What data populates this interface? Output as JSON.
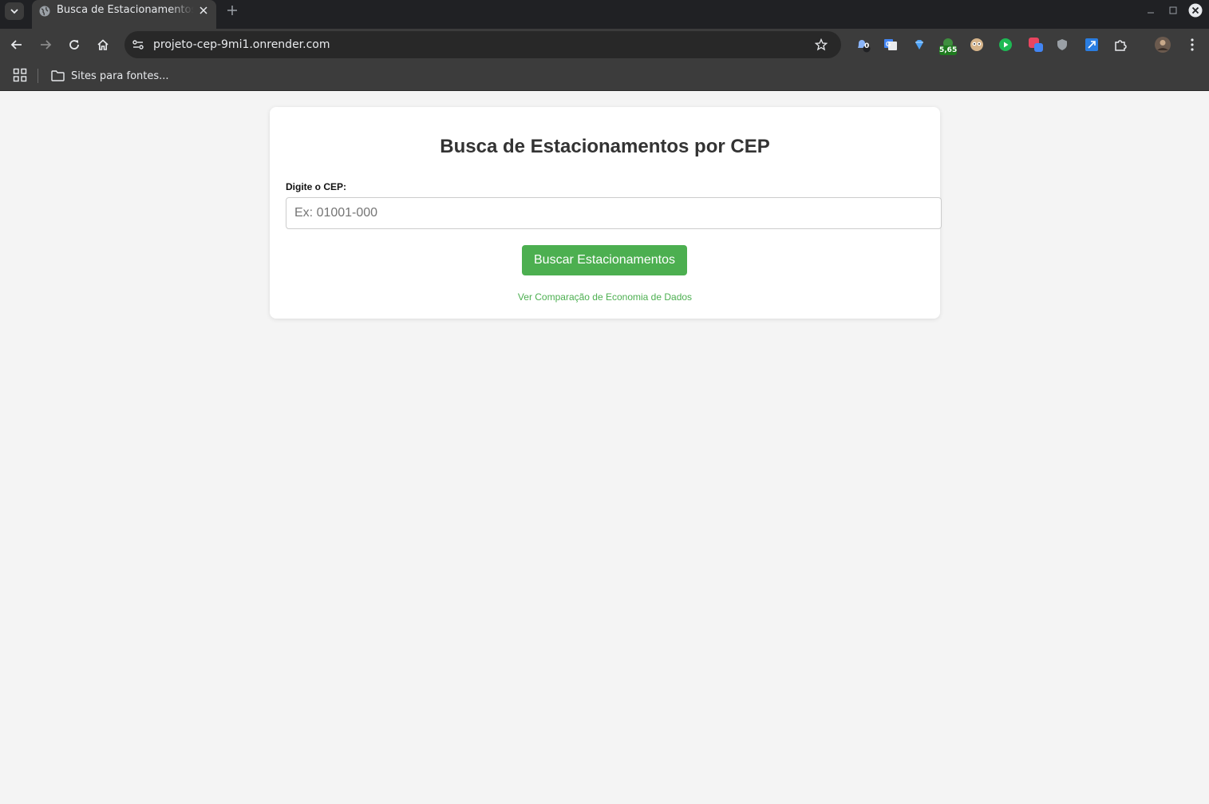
{
  "browser": {
    "tab_title": "Busca de Estacionamentos por CEP",
    "url": "projeto-cep-9mi1.onrender.com",
    "bookmark_folder": "Sites para fontes...",
    "extension_badges": {
      "notifications_count": "0",
      "price_badge": "5,65"
    },
    "icons": [
      "tab-search-icon",
      "globe-icon",
      "close-icon",
      "plus-icon",
      "minimize-icon",
      "maximize-icon",
      "window-close-icon",
      "back-arrow-icon",
      "forward-arrow-icon",
      "reload-icon",
      "home-icon",
      "site-info-icon",
      "star-icon",
      "puzzle-icon",
      "kebab-menu-icon",
      "apps-grid-icon",
      "folder-icon"
    ]
  },
  "page": {
    "title": "Busca de Estacionamentos por CEP",
    "cep_label": "Digite o CEP:",
    "cep_placeholder": "Ex: 01001-000",
    "cep_value": "",
    "search_button": "Buscar Estacionamentos",
    "compare_link": "Ver Comparação de Economia de Dados"
  },
  "colors": {
    "accent_green": "#4caf50",
    "page_background": "#f4f4f4",
    "card_background": "#ffffff",
    "title_text": "#333333"
  }
}
